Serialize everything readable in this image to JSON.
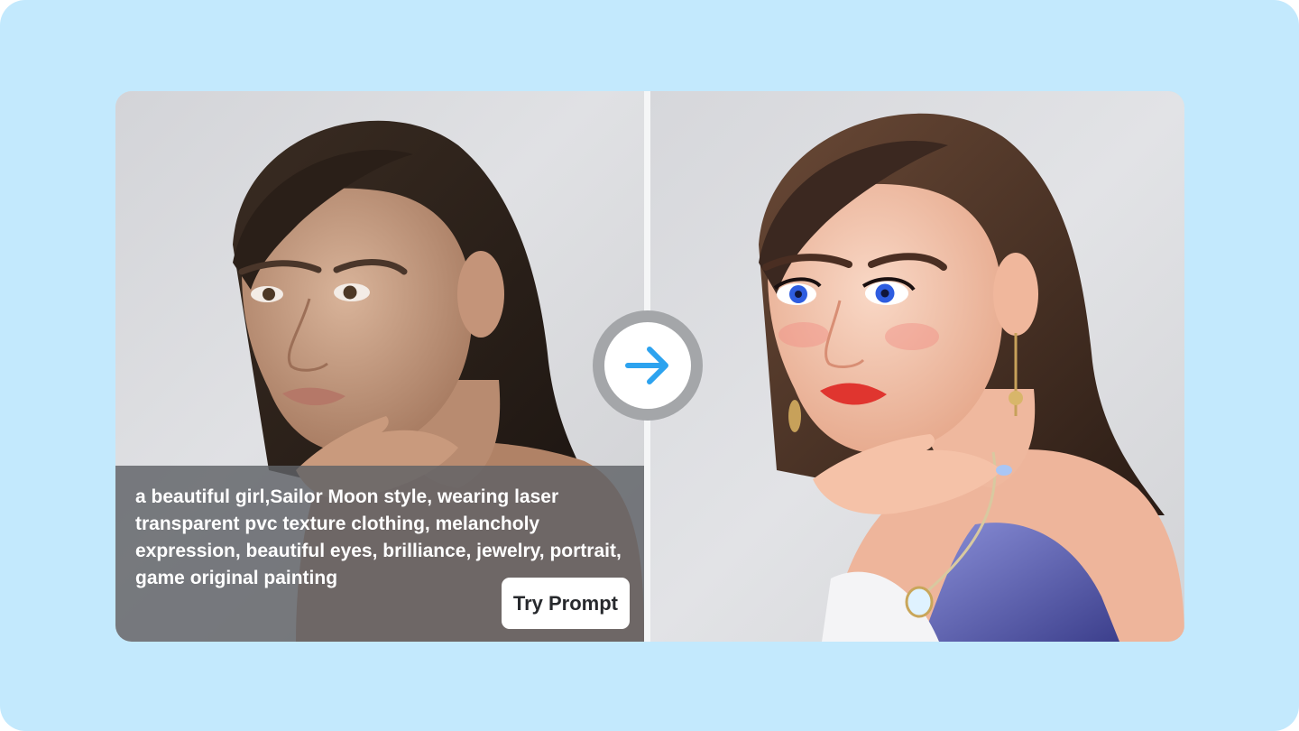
{
  "comparison": {
    "prompt_text": "a beautiful girl,Sailor Moon style, wearing laser transparent pvc texture clothing, melancholy expression, beautiful eyes, brilliance, jewelry, portrait, game original painting",
    "try_prompt_label": "Try Prompt",
    "left_image": "realistic-portrait-photo",
    "right_image": "anime-style-portrait-illustration",
    "arrow_icon": "arrow-right-icon"
  },
  "colors": {
    "page_background": "#c3e9fd",
    "arrow_accent": "#2da3ef",
    "arrow_ring": "#a4a6a9",
    "caption_overlay": "#5f6266"
  }
}
